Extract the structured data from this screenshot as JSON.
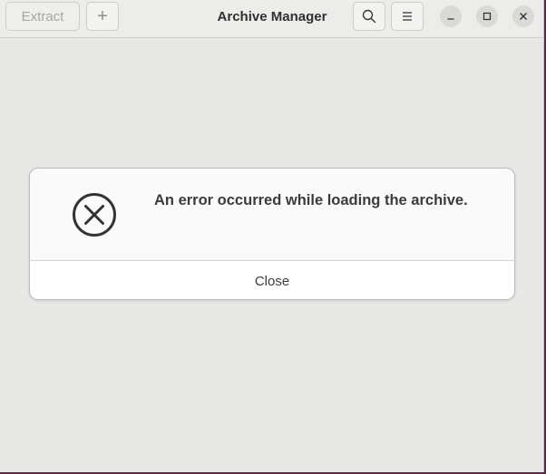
{
  "window": {
    "title": "Archive Manager"
  },
  "headerbar": {
    "extract_label": "Extract",
    "add_glyph": "+",
    "search_icon": "search-icon",
    "menu_icon": "hamburger-menu-icon",
    "window_controls": [
      "minimize-icon",
      "maximize-icon",
      "close-icon"
    ]
  },
  "dialog": {
    "icon": "error-circle-x-icon",
    "message": "An error occurred while loading the archive.",
    "close_label": "Close"
  },
  "colors": {
    "window_bg": "#e8e8e7",
    "headerbar_bg": "#ececeb",
    "dialog_bg": "#fafafa",
    "text": "#3b3b3b"
  }
}
